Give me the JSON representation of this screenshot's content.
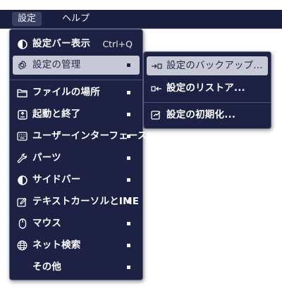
{
  "menubar": {
    "items": [
      {
        "label": "設定"
      },
      {
        "label": "ヘルプ"
      }
    ]
  },
  "settings_menu": {
    "items": [
      {
        "label": "設定バー表示",
        "shortcut": "Ctrl+Q",
        "icon": "half-circle-icon"
      },
      {
        "label": "設定の管理",
        "icon": "gear-icon"
      },
      {
        "label": "ファイルの場所",
        "icon": "folder-icon"
      },
      {
        "label": "起動と終了",
        "icon": "power-box-icon"
      },
      {
        "label": "ユーザーインターフェース",
        "icon": "keyboard-icon"
      },
      {
        "label": "パーツ",
        "icon": "wrench-icon"
      },
      {
        "label": "サイドバー",
        "icon": "half-circle-icon"
      },
      {
        "label": "テキストカーソルとIME",
        "icon": "edit-cursor-icon"
      },
      {
        "label": "マウス",
        "icon": "mouse-icon"
      },
      {
        "label": "ネット検索",
        "icon": "globe-icon"
      },
      {
        "label": "その他",
        "icon": ""
      }
    ]
  },
  "manage_submenu": {
    "items": [
      {
        "label": "設定のバックアップ...",
        "icon": "export-icon"
      },
      {
        "label": "設定のリストア...",
        "icon": "import-icon"
      },
      {
        "label": "設定の初期化...",
        "icon": "reset-icon"
      }
    ]
  },
  "colors": {
    "menu_bg": "#1d2143",
    "highlight": "#c8c9d6",
    "menubar_bg": "#1b1f3f"
  }
}
